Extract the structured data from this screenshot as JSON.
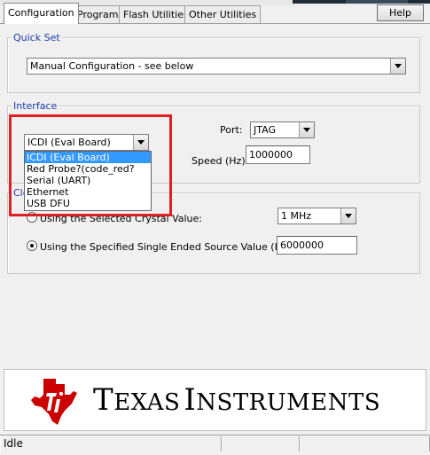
{
  "tabs": [
    "Configuration",
    "Program",
    "Flash Utilities",
    "Other Utilities"
  ],
  "help_button": "Help",
  "quick_set": {
    "title": "Quick Set",
    "selected": "Manual Configuration - see below"
  },
  "interface": {
    "title": "Interface",
    "selected": "ICDI (Eval Board)",
    "options": [
      "ICDI (Eval Board)",
      "Red Probe?(code_red?",
      "Serial (UART)",
      "Ethernet",
      "USB DFU"
    ],
    "port_label": "Port:",
    "port_value": "JTAG",
    "speed_label": "Speed (Hz):",
    "speed_value": "1000000"
  },
  "clock": {
    "title_visible": "Clo",
    "radio_crystal_label": "Using the Selected Crystal Value:",
    "crystal_value": "1 MHz",
    "radio_source_label": "Using the Specified Single Ended Source Value (Hz):",
    "source_value": "6000000"
  },
  "logo": {
    "brand_text_first_big": "T",
    "brand_text_first_rest": "EXAS",
    "brand_text_second_big": "I",
    "brand_text_second_rest": "NSTRUMENTS",
    "logo_color": "#cc0000"
  },
  "status": {
    "text": "Idle",
    "cell2": "",
    "cell3": ""
  },
  "colors": {
    "group_title": "#1c3aa9",
    "highlight": "#e02020",
    "selection": "#3399ff"
  }
}
